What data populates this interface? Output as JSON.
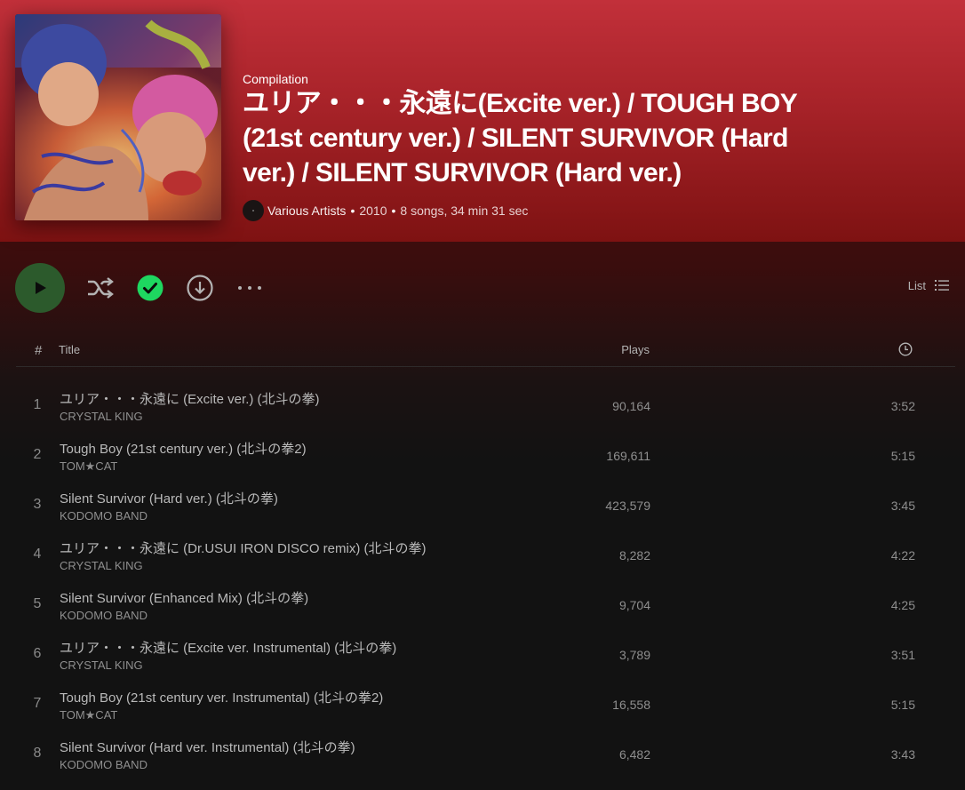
{
  "header": {
    "type_label": "Compilation",
    "title": "ユリア・・・永遠に(Excite ver.) / TOUGH BOY (21st century ver.) / SILENT SURVIVOR (Hard ver.) / SILENT SURVIVOR (Hard ver.)",
    "artist": "Various Artists",
    "year": "2010",
    "summary": "8 songs, 34 min 31 sec",
    "separator": "•"
  },
  "colors": {
    "hero_top": "#c2303a",
    "hero_bottom": "#7e1212",
    "accent_green": "#1ed760",
    "play_button": "#2c5a2c"
  },
  "controls": {
    "play_icon": "play-icon",
    "shuffle_icon": "shuffle-icon",
    "saved_icon": "check-circle-icon",
    "download_icon": "download-icon",
    "more_icon": "more-options-icon",
    "view_label": "List",
    "view_icon": "list-icon"
  },
  "table": {
    "headers": {
      "number": "#",
      "title": "Title",
      "plays": "Plays",
      "duration_icon": "clock-icon"
    },
    "tracks": [
      {
        "number": "1",
        "title": "ユリア・・・永遠に (Excite ver.) (北斗の拳)",
        "artist": "CRYSTAL KING",
        "plays": "90,164",
        "duration": "3:52"
      },
      {
        "number": "2",
        "title": "Tough Boy (21st century ver.) (北斗の拳2)",
        "artist": "TOM★CAT",
        "plays": "169,611",
        "duration": "5:15"
      },
      {
        "number": "3",
        "title": "Silent Survivor (Hard ver.) (北斗の拳)",
        "artist": "KODOMO BAND",
        "plays": "423,579",
        "duration": "3:45"
      },
      {
        "number": "4",
        "title": "ユリア・・・永遠に (Dr.USUI IRON DISCO remix) (北斗の拳)",
        "artist": "CRYSTAL KING",
        "plays": "8,282",
        "duration": "4:22"
      },
      {
        "number": "5",
        "title": "Silent Survivor (Enhanced Mix) (北斗の拳)",
        "artist": "KODOMO BAND",
        "plays": "9,704",
        "duration": "4:25"
      },
      {
        "number": "6",
        "title": "ユリア・・・永遠に (Excite ver. Instrumental) (北斗の拳)",
        "artist": "CRYSTAL KING",
        "plays": "3,789",
        "duration": "3:51"
      },
      {
        "number": "7",
        "title": "Tough Boy (21st century ver. Instrumental) (北斗の拳2)",
        "artist": "TOM★CAT",
        "plays": "16,558",
        "duration": "5:15"
      },
      {
        "number": "8",
        "title": "Silent Survivor (Hard ver. Instrumental) (北斗の拳)",
        "artist": "KODOMO BAND",
        "plays": "6,482",
        "duration": "3:43"
      }
    ]
  }
}
